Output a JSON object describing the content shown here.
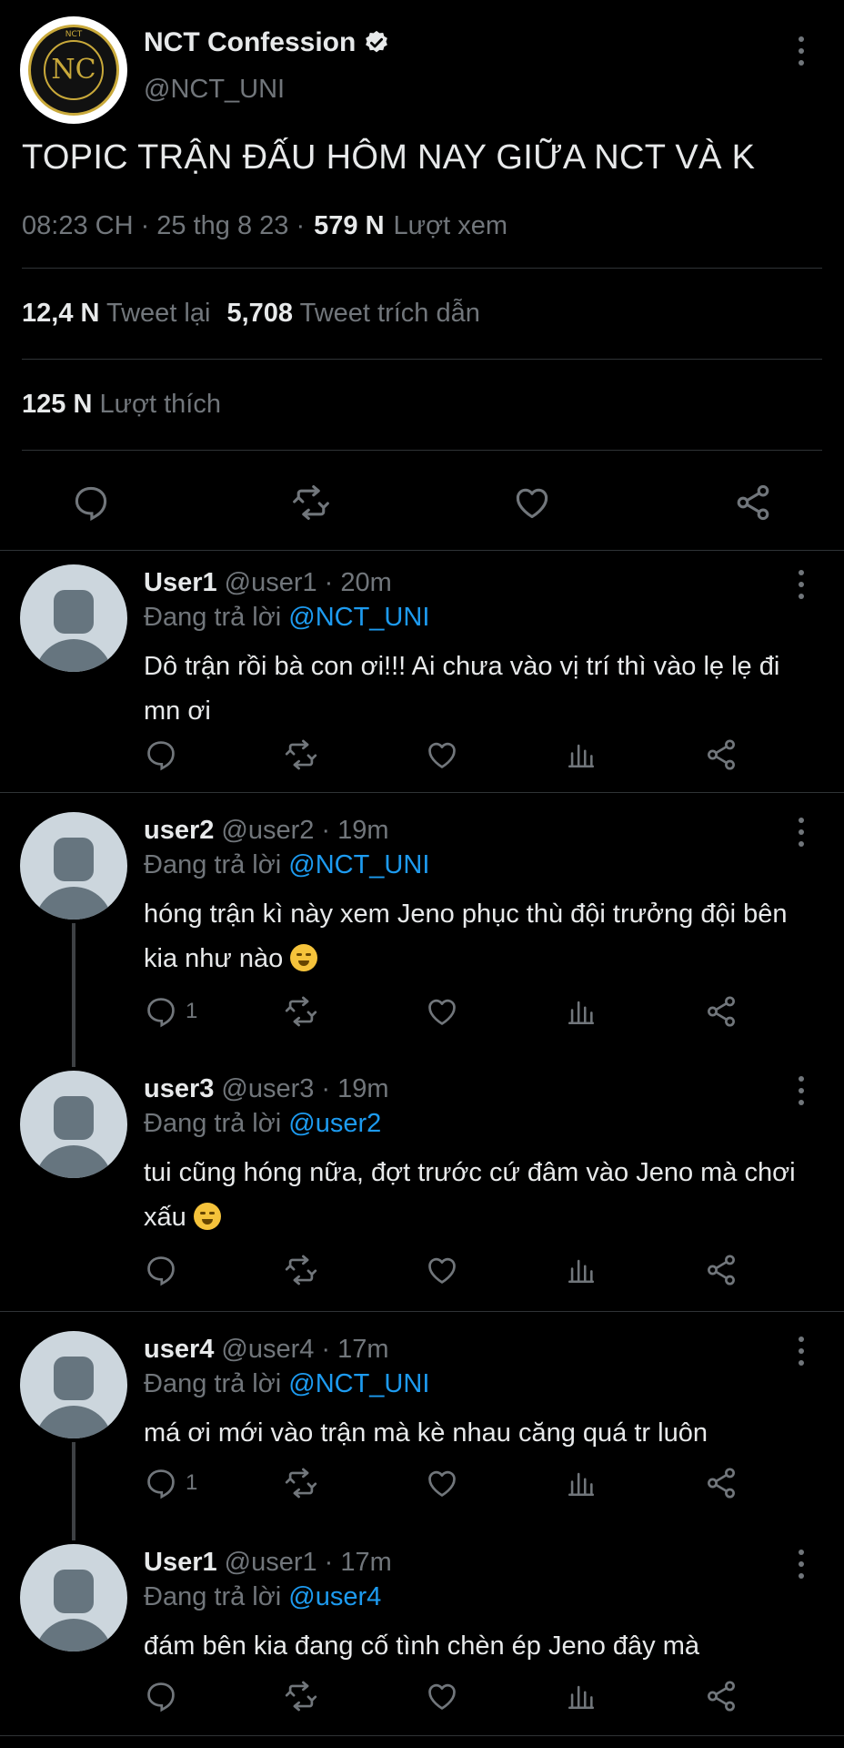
{
  "main": {
    "name": "NCT Confession",
    "handle": "@NCT_UNI",
    "logo_text": "NCT",
    "logo_mark": "NC",
    "text": "TOPIC TRẬN ĐẤU HÔM NAY GIỮA NCT VÀ K",
    "time": "08:23 CH · 25 thg 8 23 ·",
    "views_count": "579 N",
    "views_label": "Lượt xem",
    "retweets_count": "12,4 N",
    "retweets_label": "Tweet lại",
    "quotes_count": "5,708",
    "quotes_label": "Tweet trích dẫn",
    "likes_count": "125 N",
    "likes_label": "Lượt thích"
  },
  "replying_label": "Đang trả lời",
  "replies": [
    {
      "name": "User1",
      "handle": "@user1",
      "time": "· 20m",
      "reply_to": "@NCT_UNI",
      "text": "Dô trận rồi bà con ơi!!! Ai chưa vào vị trí thì vào lẹ lẹ đi mn ơi",
      "reply_count": ""
    },
    {
      "name": "user2",
      "handle": "@user2",
      "time": "· 19m",
      "reply_to": "@NCT_UNI",
      "text": "hóng trận kì này xem Jeno phục thù đội trưởng đội bên kia như nào",
      "reply_count": "1"
    },
    {
      "name": "user3",
      "handle": "@user3",
      "time": "· 19m",
      "reply_to": "@user2",
      "text": "tui cũng hóng nữa, đợt trước cứ đâm vào Jeno mà chơi xấu",
      "reply_count": ""
    },
    {
      "name": "user4",
      "handle": "@user4",
      "time": "· 17m",
      "reply_to": "@NCT_UNI",
      "text": "má ơi mới vào trận mà kè nhau căng quá tr luôn",
      "reply_count": "1"
    },
    {
      "name": "User1",
      "handle": "@user1",
      "time": "· 17m",
      "reply_to": "@user4",
      "text": "đám bên kia đang cố tình chèn ép Jeno đây mà",
      "reply_count": ""
    }
  ],
  "colors": {
    "background": "#000000",
    "link": "#1d9bf0",
    "muted": "#71767b",
    "text": "#e7e9ea",
    "logo_gold": "#c9a93a"
  }
}
